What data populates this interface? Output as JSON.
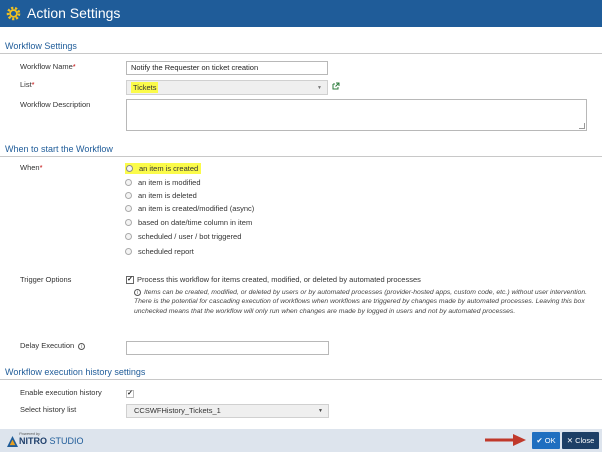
{
  "window": {
    "title": "Action Settings"
  },
  "workflow_settings": {
    "heading": "Workflow Settings",
    "name_label": "Workflow Name",
    "name_value": "Notify the Requester on ticket creation",
    "list_label": "List",
    "list_value": "Tickets",
    "description_label": "Workflow Description",
    "description_value": ""
  },
  "when_section": {
    "heading": "When to start the Workflow",
    "when_label": "When",
    "options": [
      "an item is created",
      "an item is modified",
      "an item is deleted",
      "an item is created/modified (async)",
      "based on date/time column in item",
      "scheduled / user / bot triggered",
      "scheduled report"
    ],
    "selected_index": 0,
    "trigger_label": "Trigger Options",
    "trigger_checkbox_text": "Process this workflow for items created, modified, or deleted by automated processes",
    "trigger_checked": true,
    "trigger_note": "Items can be created, modified, or deleted by users or by automated processes (provider-hosted apps, custom code, etc.) without user intervention. There is the potential for cascading execution of workflows when workflows are triggered by changes made by automated processes. Leaving this box unchecked means that the workflow will only run when changes are made by logged in users and not by automated processes.",
    "delay_label": "Delay Execution",
    "delay_value": ""
  },
  "history": {
    "heading": "Workflow execution history settings",
    "enable_label": "Enable execution history",
    "enable_checked": true,
    "select_label": "Select history list",
    "select_value": "CCSWFHistory_Tickets_1"
  },
  "footer": {
    "powered_by": "Powered by",
    "brand_strong": "NITRO",
    "brand_light": " STUDIO",
    "ok_label": "OK",
    "close_label": "Close"
  },
  "colors": {
    "accent": "#1f5c99",
    "highlight": "#fbfb4a",
    "ok": "#1f6fc0",
    "close": "#1d3f66",
    "arrow": "#c0392b"
  }
}
